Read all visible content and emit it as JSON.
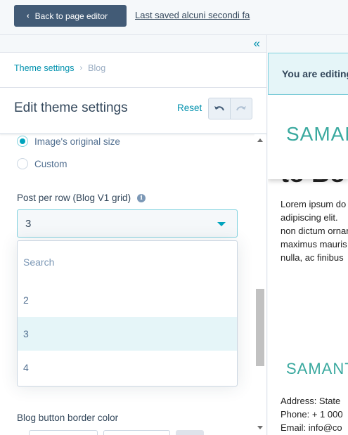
{
  "topbar": {
    "back_label": "Back to page editor",
    "last_saved": "Last saved alcuni secondi fa"
  },
  "panel": {
    "breadcrumb": {
      "parent": "Theme settings",
      "current": "Blog"
    },
    "title": "Edit theme settings",
    "reset_label": "Reset",
    "image_size": {
      "options": [
        "Image's original size",
        "Custom"
      ],
      "selected": "Image's original size"
    },
    "post_per_row": {
      "label": "Post per row (Blog V1 grid)",
      "value": "3",
      "dropdown": {
        "search_placeholder": "Search",
        "options": [
          "2",
          "3",
          "4"
        ],
        "selected": "3"
      }
    },
    "next_field_label": "Blog button border color",
    "color_swatch": "#0b5e63"
  },
  "preview": {
    "notice": "You are editing",
    "logo": "SAMANTHA",
    "heading": "to Bo",
    "body_lines": [
      "Lorem ipsum do",
      "adipiscing elit.",
      "non dictum ornar",
      "maximus mauris",
      "nulla, ac finibus"
    ],
    "footer_logo": "SAMANTHA",
    "footer_lines": [
      "Address: State",
      "Phone: + 1 000",
      "Email: info@co"
    ],
    "brand_color": "#3aa99f"
  }
}
